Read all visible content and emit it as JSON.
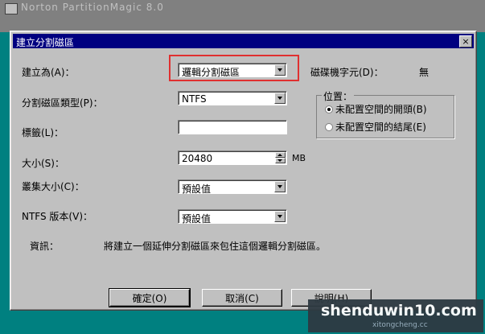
{
  "background": {
    "title": "Norton PartitionMagic 8.0"
  },
  "dialog": {
    "title": "建立分割磁區",
    "close_label": "×",
    "labels": {
      "create_as": "建立為(A)：",
      "partition_type": "分割磁區類型(P)：",
      "label": "標籤(L)：",
      "size": "大小(S)：",
      "cluster_size": "叢集大小(C)：",
      "ntfs_version": "NTFS 版本(V)：",
      "drive_letter": "磁碟機字元(D)：",
      "drive_letter_value": "無",
      "size_unit": "MB",
      "info": "資訊：",
      "info_text": "將建立一個延伸分割磁區來包住這個邏輯分割磁區。"
    },
    "fields": {
      "create_as": "邏輯分割磁區",
      "partition_type": "NTFS",
      "label": "",
      "size": "20480",
      "cluster_size": "預設值",
      "ntfs_version": "預設值"
    },
    "position_group": {
      "title": "位置：",
      "options": [
        {
          "label": "未配置空間的開頭(B)",
          "selected": true
        },
        {
          "label": "未配置空間的結尾(E)",
          "selected": false
        }
      ]
    },
    "buttons": {
      "ok": "確定(O)",
      "cancel": "取消(C)",
      "help": "說明(H)"
    }
  },
  "watermark": {
    "main": "shenduwin10.com",
    "sub": "xitongcheng.cc"
  },
  "colors": {
    "highlight": "#e03030",
    "titlebar": "#000080"
  }
}
